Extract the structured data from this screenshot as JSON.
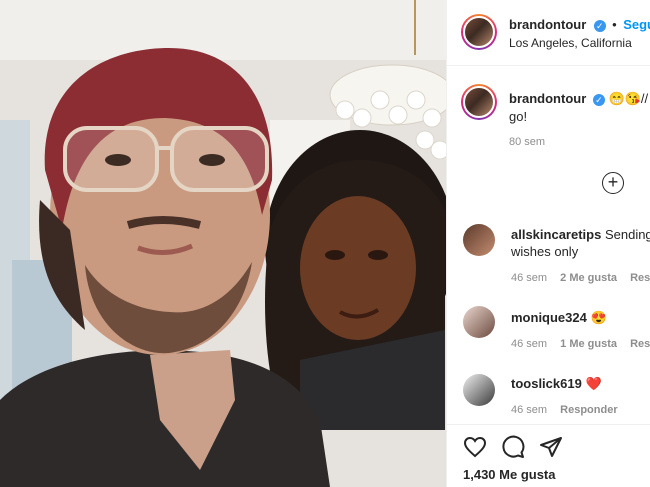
{
  "post": {
    "header": {
      "username": "brandontour",
      "follow_label": "Seguir",
      "location": "Los Angeles, California"
    },
    "caption": {
      "username": "brandontour",
      "text": "😁😘// 💪",
      "text_line2": "go!",
      "time": "80 sem"
    },
    "load_more_icon": "plus-circle-icon",
    "comments": [
      {
        "username": "allskincaretips",
        "text": "Sending",
        "text_line2": "wishes only",
        "time": "46 sem",
        "likes": "2 Me gusta",
        "reply": "Responder"
      },
      {
        "username": "monique324",
        "text": "😍",
        "time": "46 sem",
        "likes": "1 Me gusta",
        "reply": "Responder"
      },
      {
        "username": "tooslick619",
        "text": "❤️",
        "time": "46 sem",
        "reply": "Responder"
      }
    ],
    "actions": {
      "like_icon": "heart-icon",
      "comment_icon": "comment-icon",
      "share_icon": "share-icon"
    },
    "likes_count": "1,430 Me gusta"
  },
  "colors": {
    "accent_blue": "#0095f6",
    "verified_blue": "#3897f0",
    "meta_gray": "#8e8e8e",
    "border": "#efefef",
    "heart_red": "#ed4956"
  }
}
